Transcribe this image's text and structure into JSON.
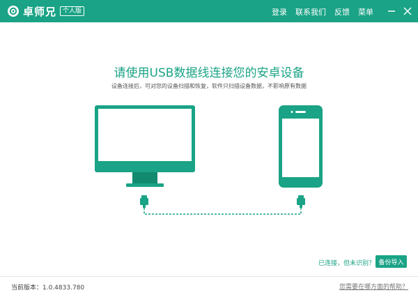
{
  "app": {
    "name": "卓师兄",
    "edition": "个人版"
  },
  "nav": {
    "login": "登录",
    "contact": "联系我们",
    "feedback": "反馈",
    "menu": "菜单"
  },
  "main": {
    "headline": "请使用USB数据线连接您的安卓设备",
    "subtitle": "设备连接后，可对您的设备扫描和恢复，软件只扫描设备数据，不影响原有数据",
    "status_link": "已连接，但未识别？",
    "backup_button": "备份导入"
  },
  "footer": {
    "version": "当前版本：1.0.4833.780",
    "help_link": "您需要在哪方面的帮助？"
  },
  "colors": {
    "accent": "#1aa386",
    "white": "#ffffff"
  }
}
